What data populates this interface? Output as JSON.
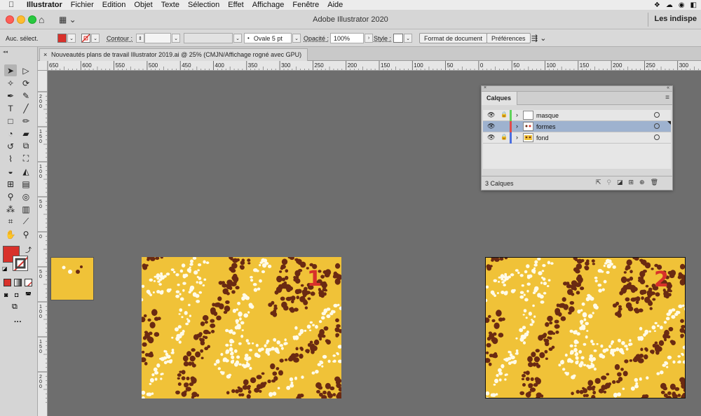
{
  "menubar": {
    "apple": "",
    "app_name": "Illustrator",
    "items": [
      "Fichier",
      "Edition",
      "Objet",
      "Texte",
      "Sélection",
      "Effet",
      "Affichage",
      "Fenêtre",
      "Aide"
    ]
  },
  "appbar": {
    "title": "Adobe Illustrator 2020",
    "right_title": "Les indispe"
  },
  "controlbar": {
    "selection_label": "Auc. sélect.",
    "fill_color": "#d8312b",
    "contour_label": "Contour :",
    "brush_label": "Ovale 5 pt",
    "opacity_label": "Opacité :",
    "opacity_value": "100%",
    "style_label": "Style :",
    "doc_format_button": "Format de document",
    "preferences_button": "Préférences"
  },
  "tab": {
    "close": "×",
    "title": "Nouveautés plans de travail Illustrator 2019.ai @ 25% (CMJN/Affichage rogné avec GPU)"
  },
  "ruler_h_labels": [
    "650",
    "600",
    "550",
    "500",
    "450",
    "400",
    "350",
    "300",
    "250",
    "200",
    "150",
    "100",
    "50",
    "0",
    "50",
    "100",
    "150",
    "200",
    "250",
    "300"
  ],
  "ruler_v_labels": [
    "2 0 0",
    "1 5 0",
    "1 0 0",
    "5 0",
    "0",
    "5 0",
    "1 0 0",
    "1 5 0",
    "2 0 0"
  ],
  "layers_panel": {
    "collapse": "«",
    "close": "×",
    "tab_label": "Calques",
    "menu_icon": "≡",
    "rows": [
      {
        "name": "masque",
        "color": "#5fd35a",
        "locked": true,
        "selected": false
      },
      {
        "name": "formes",
        "color": "#e04a4a",
        "locked": false,
        "selected": true
      },
      {
        "name": "fond",
        "color": "#4a6fe0",
        "locked": true,
        "selected": false
      }
    ],
    "footer_count": "3 Calques"
  },
  "artboards": {
    "label_1": "1",
    "label_2": "2",
    "background_color": "#f0c238",
    "dark_dot_color": "#6a2a12",
    "light_dot_color": "#fffbe8",
    "label_color": "#d8312b"
  },
  "colors": {
    "accent_fill": "#d8312b"
  }
}
